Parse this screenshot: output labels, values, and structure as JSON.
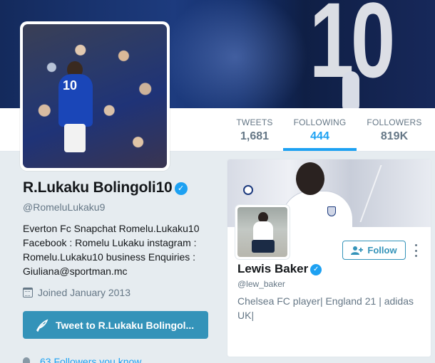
{
  "nav": {
    "stats": [
      {
        "label": "TWEETS",
        "value": "1,681"
      },
      {
        "label": "FOLLOWING",
        "value": "444"
      },
      {
        "label": "FOLLOWERS",
        "value": "819K"
      }
    ],
    "active_tab": "FOLLOWING"
  },
  "profile": {
    "name": "R.Lukaku Bolingoli10",
    "handle": "@RomeluLukaku9",
    "bio": "Everton Fc Snapchat Romelu.Lukaku10 Facebook : Romelu Lukaku instagram : Romelu.Lukaku10 business Enquiries : Giuliana@sportman.mc",
    "joined": "Joined January 2013",
    "tweet_button": "Tweet to R.Lukaku Bolingol...",
    "followers_you_know": "63 Followers you know",
    "avatar_shirt_number": "10",
    "verified_glyph": "✓"
  },
  "banner": {
    "shirt_number": "10"
  },
  "card": {
    "name": "Lewis Baker",
    "handle": "@lew_baker",
    "bio": "Chelsea FC player| England 21 | adidas UK|",
    "follow_button": "Follow",
    "verified_glyph": "✓"
  },
  "colors": {
    "accent": "#1da1f2",
    "button": "#3493b9",
    "background": "#e6ecf0"
  },
  "icons": [
    "verified-badge-icon",
    "calendar-icon",
    "quill-icon",
    "follow-user-icon",
    "more-vertical-icon",
    "people-icon"
  ]
}
